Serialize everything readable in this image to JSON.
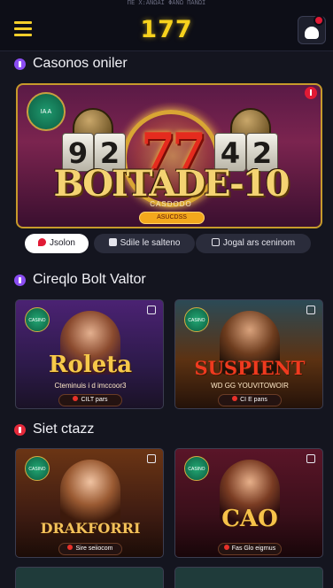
{
  "app": {
    "statusline": "ΠΕ X:ΑΝΩΑΙ ΦΑΝΩ ΠΑΝΩΙ",
    "logo_text": "177"
  },
  "colors": {
    "accent": "#f7d21d",
    "background": "#14151f",
    "alert": "#e11a35"
  },
  "icons": {
    "menu": "hamburger-menu-icon",
    "profile": "user-profile-icon",
    "alert": "alert-icon"
  },
  "sections": [
    {
      "title": "Casonos oniler",
      "icon_color": "#8b4df2"
    },
    {
      "title": "Cireqlo Bolt Valtor",
      "icon_color": "#8b4df2"
    },
    {
      "title": "Siet ctazz",
      "icon_color": "#e52a3b"
    }
  ],
  "hero": {
    "tiles_left": [
      "9",
      "2"
    ],
    "tiles_right": [
      "4",
      "2"
    ],
    "sevens": "77",
    "title": "BOITADE-10",
    "subtitle": "CASDODO",
    "cta": "ASUCDSS",
    "badge_text": "IA A"
  },
  "tabs": [
    {
      "label": "Jsolon",
      "active": true
    },
    {
      "label": "Sdile le salteno",
      "active": false
    },
    {
      "label": "Jogal ars ceninom",
      "active": false
    }
  ],
  "cards": [
    {
      "title": "Roleta",
      "subtitle": "Cteminuis i d imccoor3",
      "pill": "CILT pars",
      "badge": "CASINO",
      "bg": "#3d1d5c"
    },
    {
      "title": "SUSPIENT",
      "subtitle": "WD GG YOUVITOWOIR",
      "pill": "CI E pans",
      "badge": "CASINO",
      "bg": "#4a2a12"
    },
    {
      "title": "DRAKFORRI",
      "subtitle": "",
      "pill": "Sire seiiocom",
      "badge": "CASINO",
      "bg": "#5a2f16"
    },
    {
      "title": "CAO",
      "subtitle": "",
      "pill": "Fas Glo eigrnus",
      "badge": "CASINO",
      "bg": "#4e1424"
    }
  ]
}
